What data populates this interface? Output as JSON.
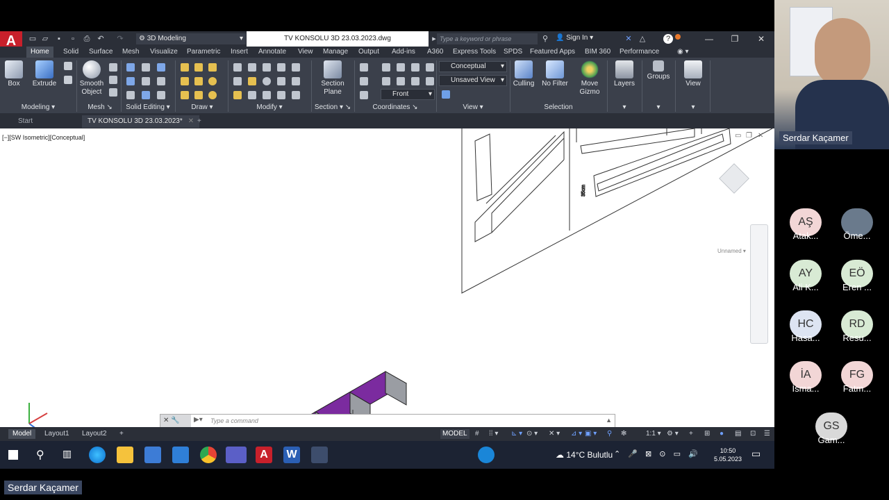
{
  "app": {
    "workspace": "3D Modeling",
    "file_title": "TV KONSOLU 3D 23.03.2023.dwg",
    "search_placeholder": "Type a keyword or phrase",
    "sign_in": "Sign In"
  },
  "ribbon_tabs": [
    "Home",
    "Solid",
    "Surface",
    "Mesh",
    "Visualize",
    "Parametric",
    "Insert",
    "Annotate",
    "View",
    "Manage",
    "Output",
    "Add-ins",
    "A360",
    "Express Tools",
    "SPDS",
    "Featured Apps",
    "BIM 360",
    "Performance"
  ],
  "ribbon": {
    "box": "Box",
    "extrude": "Extrude",
    "smooth": "Smooth\nObject",
    "section_plane": "Section\nPlane",
    "culling": "Culling",
    "no_filter": "No Filter",
    "move_gizmo": "Move\nGizmo",
    "layers": "Layers",
    "groups": "Groups",
    "view": "View",
    "visual_style": "Conceptual",
    "saved_view": "Unsaved View",
    "ucs_view": "Front",
    "panels": [
      "Modeling",
      "Mesh",
      "Solid Editing",
      "Draw",
      "Modify",
      "Section",
      "Coordinates",
      "View",
      "Selection"
    ]
  },
  "doc_tabs": {
    "start": "Start",
    "active": "TV KONSOLU 3D 23.03.2023*"
  },
  "viewport": {
    "label": "[−][SW Isometric][Conceptual]",
    "viewcube_label": "Unnamed"
  },
  "command": {
    "placeholder": "Type a command"
  },
  "layout_tabs": [
    "Model",
    "Layout1",
    "Layout2"
  ],
  "status": {
    "model": "MODEL",
    "scale": "1:1"
  },
  "taskbar": {
    "weather": "14°C  Bulutlu",
    "time": "10:50",
    "date": "5.05.2023"
  },
  "meeting": {
    "presenter": "Serdar Kaçamer",
    "bottom_name": "Serdar Kaçamer",
    "participants": [
      {
        "initials": "AŞ",
        "name": "Atak...",
        "color": "#f2d6d6"
      },
      {
        "initials": "",
        "name": "Öme...",
        "color": "#6a7a8c"
      },
      {
        "initials": "AY",
        "name": "Ali K...",
        "color": "#d8ead4"
      },
      {
        "initials": "EÖ",
        "name": "Eren ...",
        "color": "#d8ead4"
      },
      {
        "initials": "HC",
        "name": "Hasa...",
        "color": "#dde4f2"
      },
      {
        "initials": "RD",
        "name": "Resu...",
        "color": "#d8ead4"
      },
      {
        "initials": "İA",
        "name": "İsma...",
        "color": "#f2d6d6"
      },
      {
        "initials": "FG",
        "name": "Fatm...",
        "color": "#f2d6d6"
      },
      {
        "initials": "GS",
        "name": "Gam...",
        "color": "#d9d9d9"
      }
    ]
  }
}
